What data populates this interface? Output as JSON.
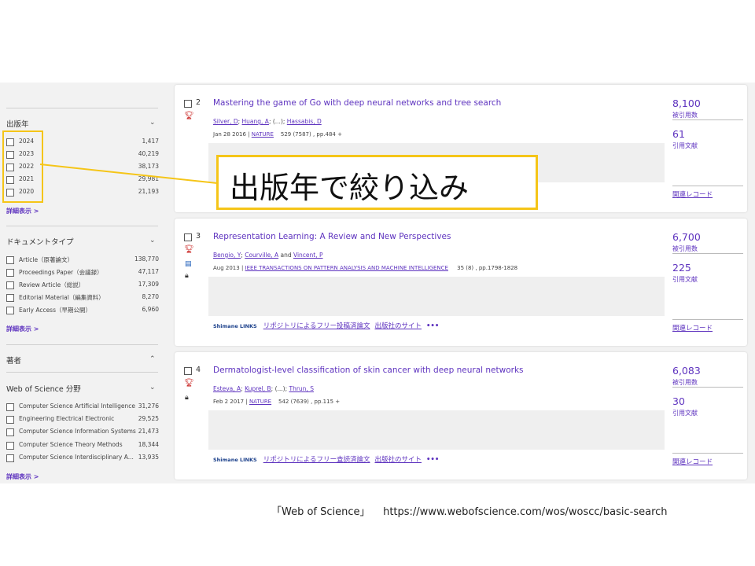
{
  "sidebar": {
    "year": {
      "title": "出版年",
      "items": [
        {
          "label": "2024",
          "count": "1,417"
        },
        {
          "label": "2023",
          "count": "40,219"
        },
        {
          "label": "2022",
          "count": "38,173"
        },
        {
          "label": "2021",
          "count": "29,981"
        },
        {
          "label": "2020",
          "count": "21,193"
        }
      ],
      "more": "詳細表示 >"
    },
    "doctype": {
      "title": "ドキュメントタイプ",
      "items": [
        {
          "label": "Article（原著論文）",
          "count": "138,770"
        },
        {
          "label": "Proceedings Paper（会議録）",
          "count": "47,117"
        },
        {
          "label": "Review Article（総説）",
          "count": "17,309"
        },
        {
          "label": "Editorial Material（編集資料）",
          "count": "8,270"
        },
        {
          "label": "Early Access（早期公開）",
          "count": "6,960"
        }
      ],
      "more": "詳細表示 >"
    },
    "author": {
      "title": "著者"
    },
    "wos": {
      "title": "Web of Science 分野",
      "items": [
        {
          "label": "Computer Science Artificial Intelligence",
          "count": "31,276"
        },
        {
          "label": "Engineering Electrical Electronic",
          "count": "29,525"
        },
        {
          "label": "Computer Science Information Systems",
          "count": "21,473"
        },
        {
          "label": "Computer Science Theory Methods",
          "count": "18,344"
        },
        {
          "label": "Computer Science Interdisciplinary A...",
          "count": "13,935"
        }
      ],
      "more": "詳細表示 >"
    }
  },
  "results": [
    {
      "index": "2",
      "title": "Mastering the game of Go with deep neural networks and tree search",
      "authors": [
        "Silver, D",
        "Huang, A",
        "(...)",
        "Hassabis, D"
      ],
      "date": "Jan 28 2016",
      "journal": "NATURE",
      "volume": "529 (7587) , pp.484 +",
      "times_cited": "8,100",
      "times_cited_label": "被引用数",
      "references": "61",
      "references_label": "引用文献",
      "related": "関連レコード"
    },
    {
      "index": "3",
      "title": "Representation Learning: A Review and New Perspectives",
      "authors": [
        "Bengio, Y",
        "Courville, A",
        "and",
        "Vincent, P"
      ],
      "date": "Aug 2013",
      "journal": "IEEE TRANSACTIONS ON PATTERN ANALYSIS AND MACHINE INTELLIGENCE",
      "volume": "35 (8) , pp.1798-1828",
      "times_cited": "6,700",
      "times_cited_label": "被引用数",
      "references": "225",
      "references_label": "引用文献",
      "links": {
        "shimane": "Shimane LINKS",
        "repo": "リポジトリによるフリー投稿済論文",
        "publisher": "出版社のサイト",
        "more": "•••"
      },
      "related": "関連レコード"
    },
    {
      "index": "4",
      "title": "Dermatologist-level classification of skin cancer with deep neural networks",
      "authors": [
        "Esteva, A",
        "Kuprel, B",
        "(...)",
        "Thrun, S"
      ],
      "date": "Feb 2 2017",
      "journal": "NATURE",
      "volume": "542 (7639) , pp.115 +",
      "times_cited": "6,083",
      "times_cited_label": "被引用数",
      "references": "30",
      "references_label": "引用文献",
      "links": {
        "shimane": "Shimane LINKS",
        "repo": "リポジトリによるフリー査読済論文",
        "publisher": "出版社のサイト",
        "more": "•••"
      },
      "related": "関連レコード"
    }
  ],
  "annotation": {
    "callout": "出版年で絞り込み",
    "highlight_color": "#f5c518"
  },
  "footer": {
    "source": "「Web of Science」",
    "url": "https://www.webofscience.com/wos/woscc/basic-search"
  },
  "colors": {
    "link": "#5e33bf",
    "trophy": "#c8201e",
    "panel_bg": "#f2f2f2"
  },
  "icons": {
    "trophy": "trophy-icon",
    "document": "document-icon",
    "lock": "lock-icon",
    "chevron": "chevron-down-icon"
  }
}
